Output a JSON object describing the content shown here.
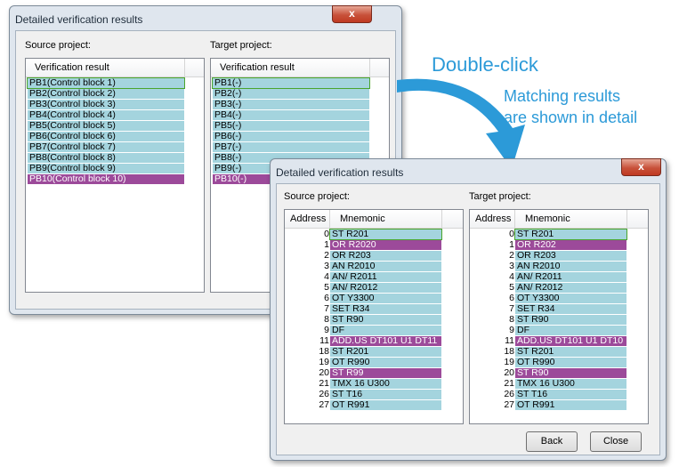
{
  "colors": {
    "match": "#a4d4de",
    "diff": "#9c4a9a",
    "diff_text": "#ffffff",
    "border_green": "#4aa42c",
    "arrow": "#2c9ad8"
  },
  "annotation": {
    "title": "Double-click",
    "line1": "Matching results",
    "line2": "are shown in detail"
  },
  "back_window": {
    "title": "Detailed verification results",
    "source_label": "Source project:",
    "target_label": "Target project:",
    "col_header": "Verification result",
    "source_rows": [
      {
        "text": "PB1(Control block 1)",
        "status": "match"
      },
      {
        "text": "PB2(Control block 2)",
        "status": "match"
      },
      {
        "text": "PB3(Control block 3)",
        "status": "match"
      },
      {
        "text": "PB4(Control block 4)",
        "status": "match"
      },
      {
        "text": "PB5(Control block 5)",
        "status": "match"
      },
      {
        "text": "PB6(Control block 6)",
        "status": "match"
      },
      {
        "text": "PB7(Control block 7)",
        "status": "match"
      },
      {
        "text": "PB8(Control block 8)",
        "status": "match"
      },
      {
        "text": "PB9(Control block 9)",
        "status": "match"
      },
      {
        "text": "PB10(Control block 10)",
        "status": "diff"
      }
    ],
    "target_rows": [
      {
        "text": "PB1(-)",
        "status": "match"
      },
      {
        "text": "PB2(-)",
        "status": "match"
      },
      {
        "text": "PB3(-)",
        "status": "match"
      },
      {
        "text": "PB4(-)",
        "status": "match"
      },
      {
        "text": "PB5(-)",
        "status": "match"
      },
      {
        "text": "PB6(-)",
        "status": "match"
      },
      {
        "text": "PB7(-)",
        "status": "match"
      },
      {
        "text": "PB8(-)",
        "status": "match"
      },
      {
        "text": "PB9(-)",
        "status": "match"
      },
      {
        "text": "PB10(-)",
        "status": "diff"
      }
    ]
  },
  "front_window": {
    "title": "Detailed verification results",
    "source_label": "Source project:",
    "target_label": "Target project:",
    "col_address": "Address",
    "col_mnemonic": "Mnemonic",
    "source_rows": [
      {
        "addr": "0",
        "mn": "ST R201",
        "status": "match"
      },
      {
        "addr": "1",
        "mn": "OR R2020",
        "status": "diff"
      },
      {
        "addr": "2",
        "mn": "OR R203",
        "status": "match"
      },
      {
        "addr": "3",
        "mn": "AN R2010",
        "status": "match"
      },
      {
        "addr": "4",
        "mn": "AN/ R2011",
        "status": "match"
      },
      {
        "addr": "5",
        "mn": "AN/ R2012",
        "status": "match"
      },
      {
        "addr": "6",
        "mn": "OT Y3300",
        "status": "match"
      },
      {
        "addr": "7",
        "mn": "SET R34",
        "status": "match"
      },
      {
        "addr": "8",
        "mn": "ST R90",
        "status": "match"
      },
      {
        "addr": "9",
        "mn": "DF",
        "status": "match"
      },
      {
        "addr": "11",
        "mn": "ADD.US DT101 U1 DT11",
        "status": "diff"
      },
      {
        "addr": "18",
        "mn": "ST R201",
        "status": "match"
      },
      {
        "addr": "19",
        "mn": "OT R990",
        "status": "match"
      },
      {
        "addr": "20",
        "mn": "ST R99",
        "status": "diff"
      },
      {
        "addr": "21",
        "mn": "TMX 16 U300",
        "status": "match"
      },
      {
        "addr": "26",
        "mn": "ST T16",
        "status": "match"
      },
      {
        "addr": "27",
        "mn": "OT R991",
        "status": "match"
      }
    ],
    "target_rows": [
      {
        "addr": "0",
        "mn": "ST R201",
        "status": "match"
      },
      {
        "addr": "1",
        "mn": "OR R202",
        "status": "diff"
      },
      {
        "addr": "2",
        "mn": "OR R203",
        "status": "match"
      },
      {
        "addr": "3",
        "mn": "AN R2010",
        "status": "match"
      },
      {
        "addr": "4",
        "mn": "AN/ R2011",
        "status": "match"
      },
      {
        "addr": "5",
        "mn": "AN/ R2012",
        "status": "match"
      },
      {
        "addr": "6",
        "mn": "OT Y3300",
        "status": "match"
      },
      {
        "addr": "7",
        "mn": "SET R34",
        "status": "match"
      },
      {
        "addr": "8",
        "mn": "ST R90",
        "status": "match"
      },
      {
        "addr": "9",
        "mn": "DF",
        "status": "match"
      },
      {
        "addr": "11",
        "mn": "ADD.US DT101 U1 DT10",
        "status": "diff"
      },
      {
        "addr": "18",
        "mn": "ST R201",
        "status": "match"
      },
      {
        "addr": "19",
        "mn": "OT R990",
        "status": "match"
      },
      {
        "addr": "20",
        "mn": "ST R90",
        "status": "diff"
      },
      {
        "addr": "21",
        "mn": "TMX 16 U300",
        "status": "match"
      },
      {
        "addr": "26",
        "mn": "ST T16",
        "status": "match"
      },
      {
        "addr": "27",
        "mn": "OT R991",
        "status": "match"
      }
    ],
    "back_button": "Back",
    "close_button": "Close",
    "close_x": "x"
  }
}
